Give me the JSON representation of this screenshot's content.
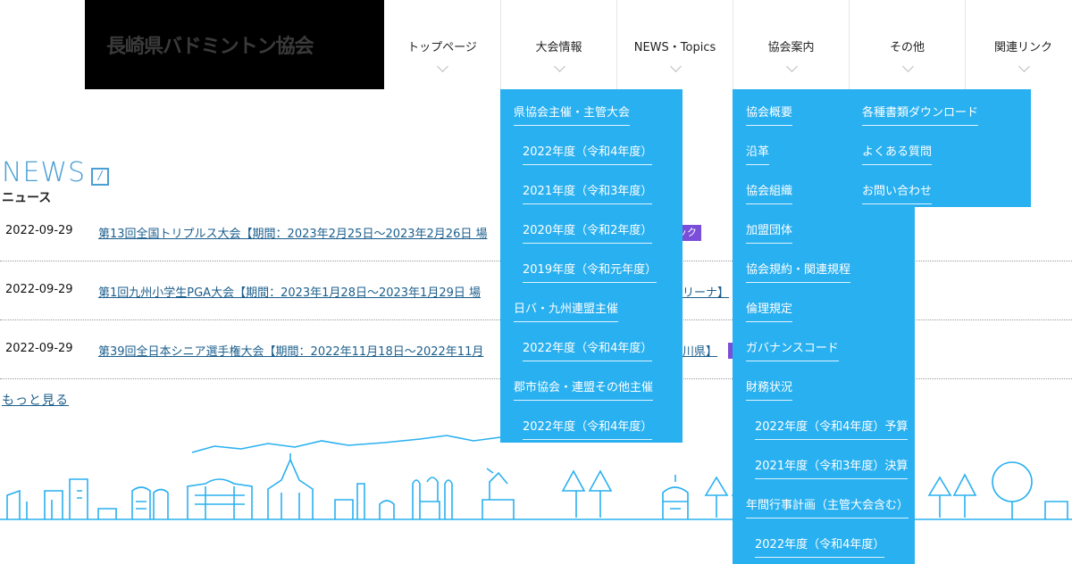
{
  "site": {
    "title": "長崎県バドミントン協会"
  },
  "nav": [
    {
      "label": "トップページ"
    },
    {
      "label": "大会情報"
    },
    {
      "label": "NEWS・Topics"
    },
    {
      "label": "協会案内"
    },
    {
      "label": "その他"
    },
    {
      "label": "関連リンク"
    }
  ],
  "news": {
    "title": "NEWS",
    "subtitle": "ニュース",
    "items": [
      {
        "date": "2022-09-29",
        "title": "第13回全国トリプルス大会【期間：2023年2月25日〜2023年2月26日 場",
        "badge": "ェック"
      },
      {
        "date": "2022-09-29",
        "title": "第1回九州小学生PGA大会【期間：2023年1月28日〜2023年1月29日 場",
        "tail": "リーナ】"
      },
      {
        "date": "2022-09-29",
        "title": "第39回全日本シニア選手権大会【期間：2022年11月18日〜2022年11月",
        "tail": "川県】"
      }
    ],
    "more_label": "もっと見る"
  },
  "dropdown_taikai": {
    "items": [
      "県協会主催・主管大会",
      "2022年度（令和4年度）",
      "2021年度（令和3年度）",
      "2020年度（令和2年度）",
      "2019年度（令和元年度）",
      "日バ・九州連盟主催",
      "2022年度（令和4年度）",
      "郡市協会・連盟その他主催",
      "2022年度（令和4年度）"
    ]
  },
  "dropdown_kyokai": {
    "col1": [
      "協会概要",
      "沿革",
      "協会組織",
      "加盟団体",
      "協会規約・関連規程",
      "倫理規定",
      "ガバナンスコード",
      "財務状況",
      "2022年度（令和4年度）予算",
      "2021年度（令和3年度）決算",
      "年間行事計画（主管大会含む）",
      "2022年度（令和4年度）"
    ],
    "col2": [
      "各種書類ダウンロード",
      "よくある質問",
      "お問い合わせ"
    ]
  },
  "colors": {
    "accent": "#29b0f0",
    "news_blue": "#4a9fd4",
    "badge": "#7a4ed8"
  }
}
